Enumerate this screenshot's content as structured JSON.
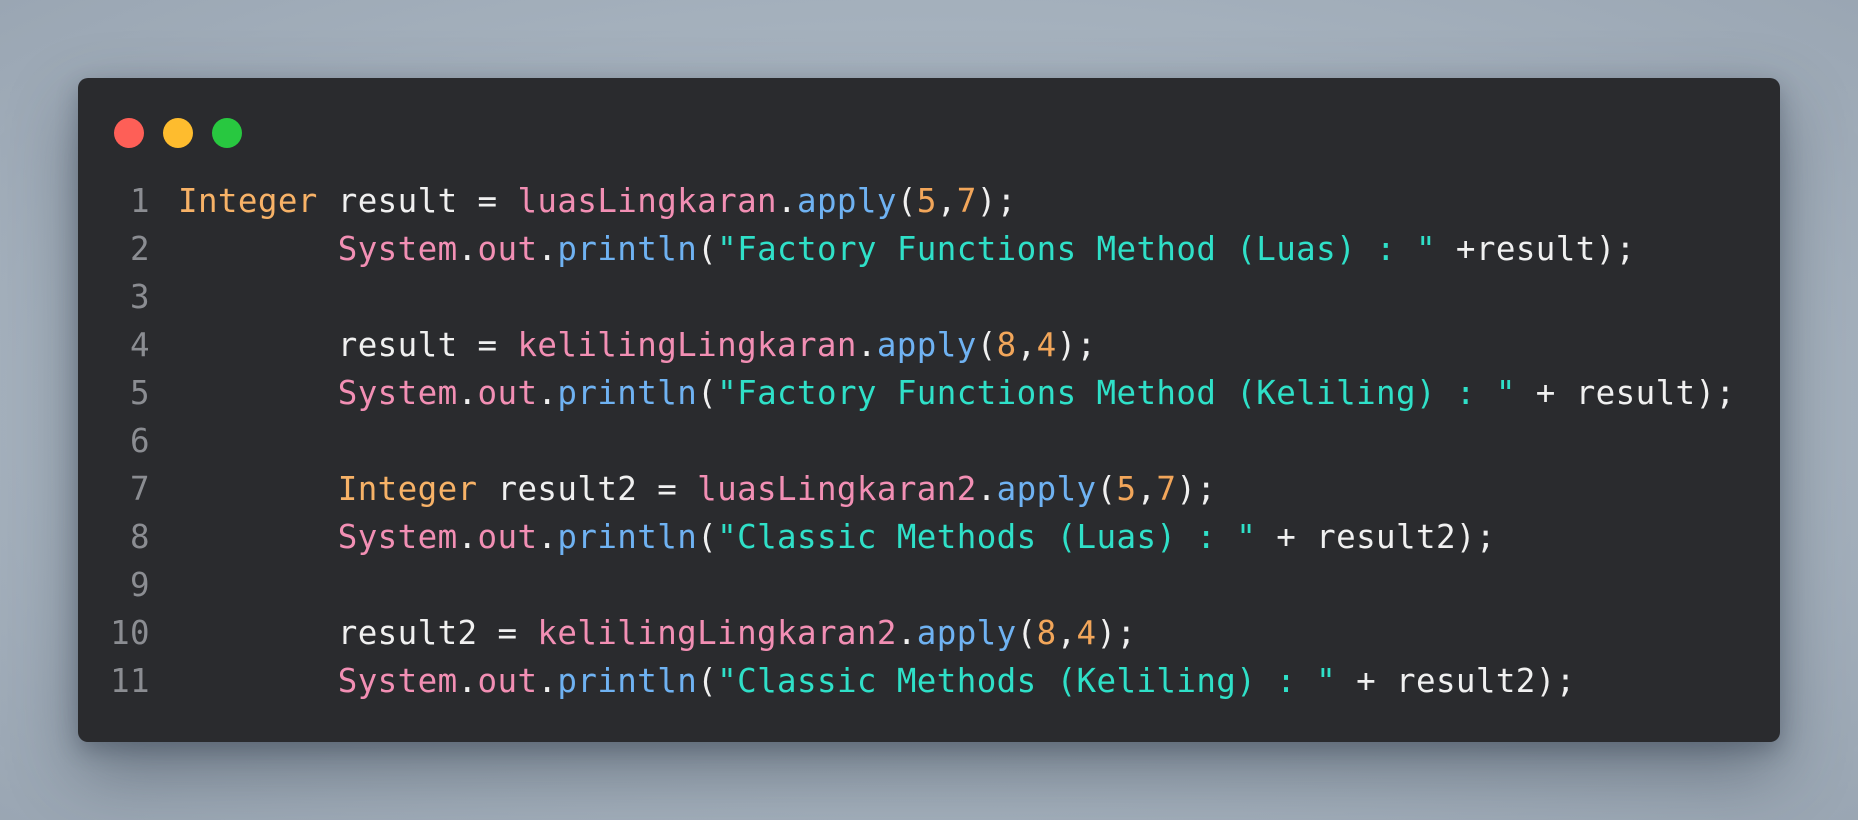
{
  "window": {
    "traffic_lights": [
      {
        "name": "close-dot",
        "color": "#fe5f57"
      },
      {
        "name": "minimize-dot",
        "color": "#febc2e"
      },
      {
        "name": "maximize-dot",
        "color": "#28c840"
      }
    ]
  },
  "code": {
    "lines": [
      {
        "n": "1",
        "tokens": [
          {
            "t": "Integer",
            "k": "type"
          },
          {
            "t": " result ",
            "k": "var"
          },
          {
            "t": "=",
            "k": "op"
          },
          {
            "t": " ",
            "k": "var"
          },
          {
            "t": "luasLingkaran",
            "k": "obj"
          },
          {
            "t": ".",
            "k": "pun"
          },
          {
            "t": "apply",
            "k": "fn"
          },
          {
            "t": "(",
            "k": "pun"
          },
          {
            "t": "5",
            "k": "num"
          },
          {
            "t": ",",
            "k": "pun"
          },
          {
            "t": "7",
            "k": "num"
          },
          {
            "t": ");",
            "k": "pun"
          }
        ]
      },
      {
        "n": "2",
        "tokens": [
          {
            "t": "        ",
            "k": "var"
          },
          {
            "t": "System",
            "k": "obj"
          },
          {
            "t": ".",
            "k": "pun"
          },
          {
            "t": "out",
            "k": "obj"
          },
          {
            "t": ".",
            "k": "pun"
          },
          {
            "t": "println",
            "k": "fn"
          },
          {
            "t": "(",
            "k": "pun"
          },
          {
            "t": "\"Factory Functions Method (Luas) : \"",
            "k": "str"
          },
          {
            "t": " +result",
            "k": "var"
          },
          {
            "t": ");",
            "k": "pun"
          }
        ]
      },
      {
        "n": "3",
        "tokens": []
      },
      {
        "n": "4",
        "tokens": [
          {
            "t": "        result ",
            "k": "var"
          },
          {
            "t": "=",
            "k": "op"
          },
          {
            "t": " ",
            "k": "var"
          },
          {
            "t": "kelilingLingkaran",
            "k": "obj"
          },
          {
            "t": ".",
            "k": "pun"
          },
          {
            "t": "apply",
            "k": "fn"
          },
          {
            "t": "(",
            "k": "pun"
          },
          {
            "t": "8",
            "k": "num"
          },
          {
            "t": ",",
            "k": "pun"
          },
          {
            "t": "4",
            "k": "num"
          },
          {
            "t": ");",
            "k": "pun"
          }
        ]
      },
      {
        "n": "5",
        "tokens": [
          {
            "t": "        ",
            "k": "var"
          },
          {
            "t": "System",
            "k": "obj"
          },
          {
            "t": ".",
            "k": "pun"
          },
          {
            "t": "out",
            "k": "obj"
          },
          {
            "t": ".",
            "k": "pun"
          },
          {
            "t": "println",
            "k": "fn"
          },
          {
            "t": "(",
            "k": "pun"
          },
          {
            "t": "\"Factory Functions Method (Keliling) : \"",
            "k": "str"
          },
          {
            "t": " + result",
            "k": "var"
          },
          {
            "t": ");",
            "k": "pun"
          }
        ]
      },
      {
        "n": "6",
        "tokens": []
      },
      {
        "n": "7",
        "tokens": [
          {
            "t": "        ",
            "k": "var"
          },
          {
            "t": "Integer",
            "k": "type"
          },
          {
            "t": " result2 ",
            "k": "var"
          },
          {
            "t": "=",
            "k": "op"
          },
          {
            "t": " ",
            "k": "var"
          },
          {
            "t": "luasLingkaran2",
            "k": "obj"
          },
          {
            "t": ".",
            "k": "pun"
          },
          {
            "t": "apply",
            "k": "fn"
          },
          {
            "t": "(",
            "k": "pun"
          },
          {
            "t": "5",
            "k": "num"
          },
          {
            "t": ",",
            "k": "pun"
          },
          {
            "t": "7",
            "k": "num"
          },
          {
            "t": ");",
            "k": "pun"
          }
        ]
      },
      {
        "n": "8",
        "tokens": [
          {
            "t": "        ",
            "k": "var"
          },
          {
            "t": "System",
            "k": "obj"
          },
          {
            "t": ".",
            "k": "pun"
          },
          {
            "t": "out",
            "k": "obj"
          },
          {
            "t": ".",
            "k": "pun"
          },
          {
            "t": "println",
            "k": "fn"
          },
          {
            "t": "(",
            "k": "pun"
          },
          {
            "t": "\"Classic Methods (Luas) : \"",
            "k": "str"
          },
          {
            "t": " + result2",
            "k": "var"
          },
          {
            "t": ");",
            "k": "pun"
          }
        ]
      },
      {
        "n": "9",
        "tokens": []
      },
      {
        "n": "10",
        "tokens": [
          {
            "t": "        result2 ",
            "k": "var"
          },
          {
            "t": "=",
            "k": "op"
          },
          {
            "t": " ",
            "k": "var"
          },
          {
            "t": "kelilingLingkaran2",
            "k": "obj"
          },
          {
            "t": ".",
            "k": "pun"
          },
          {
            "t": "apply",
            "k": "fn"
          },
          {
            "t": "(",
            "k": "pun"
          },
          {
            "t": "8",
            "k": "num"
          },
          {
            "t": ",",
            "k": "pun"
          },
          {
            "t": "4",
            "k": "num"
          },
          {
            "t": ");",
            "k": "pun"
          }
        ]
      },
      {
        "n": "11",
        "tokens": [
          {
            "t": "        ",
            "k": "var"
          },
          {
            "t": "System",
            "k": "obj"
          },
          {
            "t": ".",
            "k": "pun"
          },
          {
            "t": "out",
            "k": "obj"
          },
          {
            "t": ".",
            "k": "pun"
          },
          {
            "t": "println",
            "k": "fn"
          },
          {
            "t": "(",
            "k": "pun"
          },
          {
            "t": "\"Classic Methods (Keliling) : \"",
            "k": "str"
          },
          {
            "t": " + result2",
            "k": "var"
          },
          {
            "t": ");",
            "k": "pun"
          }
        ]
      }
    ]
  }
}
